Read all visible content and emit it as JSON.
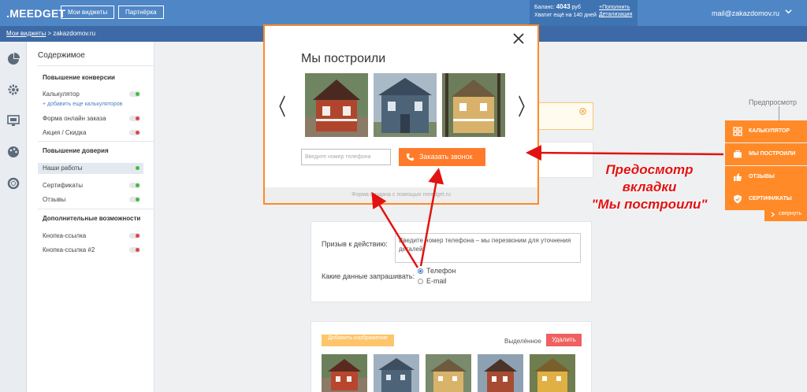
{
  "header": {
    "logo": ".MEEDGET",
    "btn_widgets": "Мои виджеты",
    "btn_partner": "Партнёрка",
    "balance_label": "Баланс:",
    "balance_value": "4043",
    "balance_currency": "руб",
    "balance_days": "Хватит ещё на 140 дней",
    "topup": "+Пополнить",
    "details": "Детализация",
    "email": "mail@zakazdomov.ru"
  },
  "breadcrumb": {
    "root": "Мои виджеты",
    "sep": " > ",
    "current": "zakazdomov.ru"
  },
  "sidebar": {
    "title": "Содержимое",
    "sections": [
      {
        "title": "Повышение конверсии"
      },
      {
        "title": "Повышение доверия"
      },
      {
        "title": "Дополнительные возможности"
      }
    ],
    "items": [
      {
        "label": "Калькулятор",
        "on": true
      },
      {
        "label": "Форма онлайн заказа",
        "on": false
      },
      {
        "label": "Акция / Скидка",
        "on": false
      },
      {
        "label": "Наши работы",
        "on": true
      },
      {
        "label": "Сертификаты",
        "on": true
      },
      {
        "label": "Отзывы",
        "on": true
      },
      {
        "label": "Кнопка-ссылка",
        "on": false
      },
      {
        "label": "Кнопка-ссылка #2",
        "on": false
      }
    ],
    "add_calc": "+ добавить еще калькуляторов"
  },
  "modal": {
    "title": "Мы построили",
    "phone_placeholder": "Введите номер телефона",
    "call_button": "Заказать звонок",
    "footer": "Форма создана с помощью meedget.ru"
  },
  "preview": {
    "label": "Предпросмотр",
    "tabs": [
      {
        "label": "КАЛЬКУЛЯТОР",
        "icon": "calculator-icon"
      },
      {
        "label": "МЫ ПОСТРОИЛИ",
        "icon": "briefcase-icon"
      },
      {
        "label": "ОТЗЫВЫ",
        "icon": "thumbs-up-icon"
      },
      {
        "label": "СЕРТИФИКАТЫ",
        "icon": "shield-icon"
      }
    ],
    "collapse": "свернуть"
  },
  "annotation": {
    "line1": "Предосмотр",
    "line2": "вкладки",
    "line3": "\"Мы построили\""
  },
  "form": {
    "cta_label": "Призыв к действию:",
    "cta_text": "Введите номер телефона – мы перезвоним для уточнения деталей",
    "ask_label": "Какие данные запрашивать:",
    "options": [
      {
        "label": "Телефон",
        "selected": true
      },
      {
        "label": "E-mail",
        "selected": false
      }
    ]
  },
  "gallery": {
    "add_button": "Добавить изображение",
    "selected_label": "Выделённое",
    "delete_button": "Удалить"
  },
  "colors": {
    "accent": "#ff8a27",
    "header": "#4f86c6",
    "annotation": "#e21212"
  }
}
